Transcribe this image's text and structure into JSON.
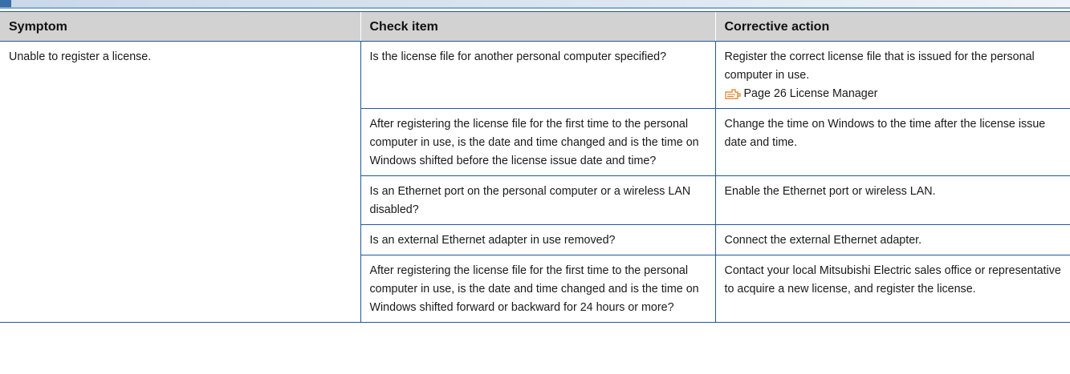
{
  "table": {
    "headers": {
      "symptom": "Symptom",
      "check_item": "Check item",
      "corrective_action": "Corrective action"
    },
    "symptom": "Unable to register a license.",
    "rows": [
      {
        "check_item": "Is the license file for another personal computer specified?",
        "corrective_action": "Register the correct license file that is issued for the personal computer in use.",
        "reference": {
          "icon": "page-reference-icon",
          "text": "Page 26 License Manager"
        }
      },
      {
        "check_item": "After registering the license file for the first time to the personal computer in use, is the date and time changed and is the time on Windows shifted before the license issue date and time?",
        "corrective_action": "Change the time on Windows to the time after the license issue date and time."
      },
      {
        "check_item": "Is an Ethernet port on the personal computer or a wireless LAN disabled?",
        "corrective_action": "Enable the Ethernet port or wireless LAN."
      },
      {
        "check_item": "Is an external Ethernet adapter in use removed?",
        "corrective_action": "Connect the external Ethernet adapter."
      },
      {
        "check_item": "After registering the license file for the first time to the personal computer in use, is the date and time changed and is the time on Windows shifted forward or backward for 24 hours or more?",
        "corrective_action": "Contact your local Mitsubishi Electric sales office or representative to acquire a new license, and register the license."
      }
    ]
  },
  "colors": {
    "header_background": "#d2d2d2",
    "rule_blue": "#1e5a9a",
    "section_band": "#c9d8ea",
    "reference_icon": "#e07a1f"
  }
}
